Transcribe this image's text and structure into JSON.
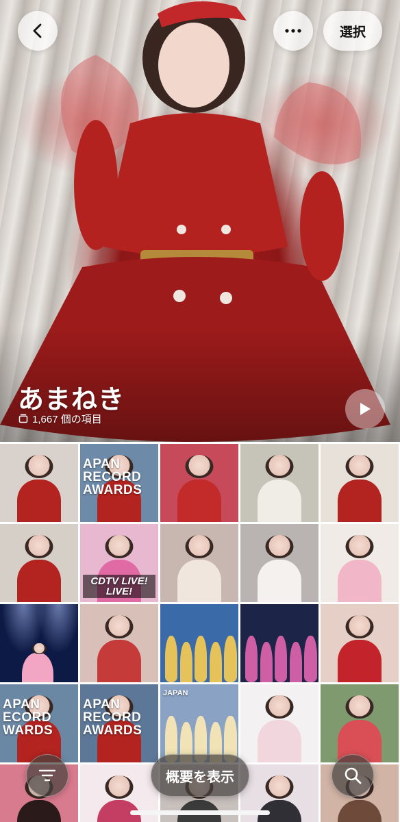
{
  "nav": {
    "back_icon": "chevron-left-icon",
    "more_icon": "ellipsis-icon",
    "select_label": "選択"
  },
  "album": {
    "title": "あまねき",
    "count_text": "1,667 個の項目",
    "count_icon": "stack-icon",
    "play_icon": "play-icon"
  },
  "grid": {
    "tiles": [
      {
        "kind": "person",
        "bg": "#d9d2cc",
        "outfit": "#b3231f"
      },
      {
        "kind": "award",
        "bg": "#6d8aa8",
        "outfit": "#b3231f",
        "text": "APAN RECORD AWARDS"
      },
      {
        "kind": "person",
        "bg": "#c74a5a",
        "outfit": "#c22b2a"
      },
      {
        "kind": "person",
        "bg": "#c6c3b8",
        "outfit": "#f0ece6"
      },
      {
        "kind": "person",
        "bg": "#e8e1da",
        "outfit": "#b3231f"
      },
      {
        "kind": "person",
        "bg": "#d6cfc7",
        "outfit": "#b3231f"
      },
      {
        "kind": "cdtv",
        "bg": "#e7b8cf",
        "outfit": "#e06aa4",
        "text": "CDTV LIVE! LIVE!"
      },
      {
        "kind": "person",
        "bg": "#c7b7b0",
        "outfit": "#f0e6de"
      },
      {
        "kind": "person",
        "bg": "#b9b4b2",
        "outfit": "#f4f1ee"
      },
      {
        "kind": "person",
        "bg": "#f1ebe7",
        "outfit": "#f1b7c8"
      },
      {
        "kind": "stage",
        "bg": "#0d1a45",
        "outfit": "#f2a6c4"
      },
      {
        "kind": "person",
        "bg": "#d8bfb8",
        "outfit": "#c43b3a"
      },
      {
        "kind": "group",
        "bg": "#3b6aa8",
        "outfit": "#e6c35a"
      },
      {
        "kind": "group",
        "bg": "#1c2548",
        "outfit": "#cf5fa4"
      },
      {
        "kind": "person",
        "bg": "#e5cfc6",
        "outfit": "#c3232a"
      },
      {
        "kind": "award",
        "bg": "#6a87a4",
        "outfit": "#b3231f",
        "text": "APAN ECORD WARDS"
      },
      {
        "kind": "award",
        "bg": "#5c7797",
        "outfit": "#b3231f",
        "text": "APAN RECORD AWARDS"
      },
      {
        "kind": "group",
        "bg": "#8aa3c4",
        "outfit": "#f1e3b5",
        "text": "JAPAN"
      },
      {
        "kind": "person",
        "bg": "#f3f1f2",
        "outfit": "#f1d6de"
      },
      {
        "kind": "person",
        "bg": "#7f9a6e",
        "outfit": "#d94f55"
      },
      {
        "kind": "person",
        "bg": "#d97b8e",
        "outfit": "#2a1a1a"
      },
      {
        "kind": "person",
        "bg": "#f4eaee",
        "outfit": "#c43e63"
      },
      {
        "kind": "person",
        "bg": "#c8c0bd",
        "outfit": "#3b3b3b"
      },
      {
        "kind": "person",
        "bg": "#e8dfe4",
        "outfit": "#2f2f35"
      },
      {
        "kind": "person",
        "bg": "#d1b4a5",
        "outfit": "#6e4a3a"
      }
    ]
  },
  "bottom_bar": {
    "filter_icon": "sort-lines-icon",
    "summary_label": "概要を表示",
    "search_icon": "search-icon"
  },
  "colors": {
    "hero_dress": "#a8201f",
    "hero_curtain": "#d8d2cc",
    "button_light": "#ffffff",
    "button_dark": "#464240"
  }
}
